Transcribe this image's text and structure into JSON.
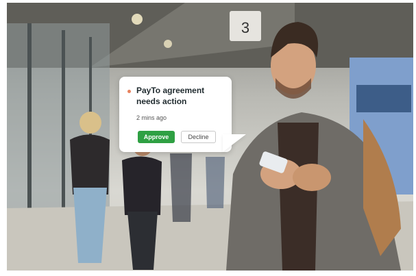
{
  "notification": {
    "title": "PayTo agreement needs action",
    "time": "2 mins ago",
    "approve_label": "Approve",
    "decline_label": "Decline",
    "colors": {
      "approve": "#2fa043",
      "dot": "#e8825e"
    }
  },
  "scene": {
    "platform_sign": "3"
  }
}
